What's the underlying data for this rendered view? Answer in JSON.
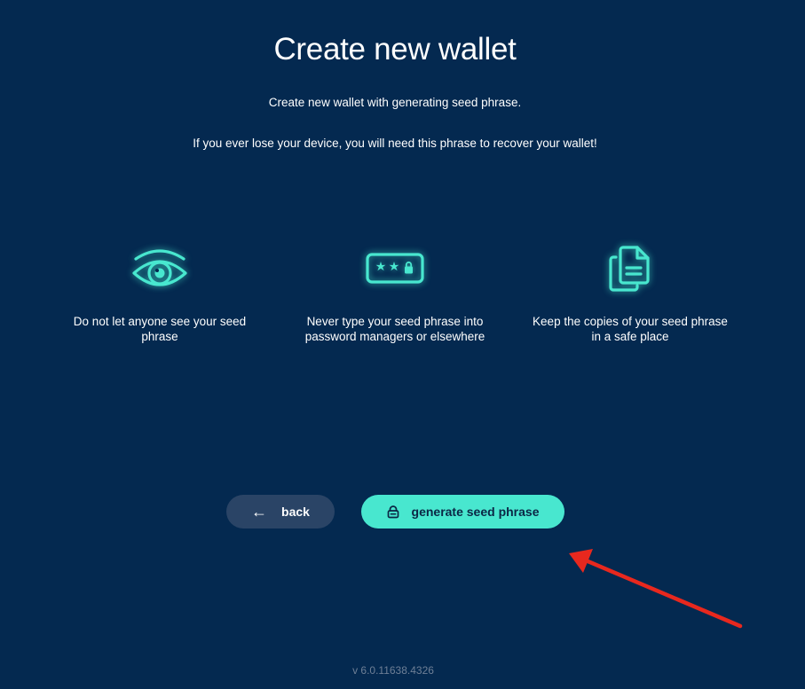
{
  "page": {
    "title": "Create new wallet",
    "subtitle": "Create new wallet with generating seed phrase.",
    "warning": "If you ever lose your device, you will need this phrase to recover your wallet!"
  },
  "tips": [
    {
      "icon": "eye-icon",
      "text": "Do not let anyone see your seed phrase"
    },
    {
      "icon": "password-icon",
      "text": "Never type your seed phrase into password managers or elsewhere"
    },
    {
      "icon": "copies-icon",
      "text": "Keep the copies of your seed phrase in a safe place"
    }
  ],
  "buttons": {
    "back_label": "back",
    "generate_label": "generate seed phrase"
  },
  "version": "v 6.0.11638.4326",
  "colors": {
    "background": "#042950",
    "accent": "#48e7cf",
    "secondary_button": "#2a4466",
    "annotation_arrow": "#e8281e"
  }
}
